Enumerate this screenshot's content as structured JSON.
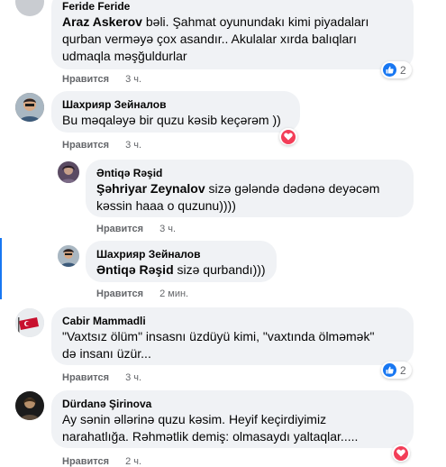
{
  "comments": [
    {
      "author": "Feride Feride",
      "mention": "Araz Askerov",
      "text": " bəli. Şahmat oyunundakı kimi piyadaları qurban verməyə çox asandır.. Akulalar xırda balıqları udmaqla məşğuldurlar",
      "line1": " bəli. Şahmat oyunundakı kimi piyadaları",
      "line2": "qurban verməyə çox asandır.. Akulalar xırda balıqları",
      "line3": "udmaqla məşğuldurlar",
      "like_label": "Нравится",
      "time": "3 ч.",
      "reaction_count": "2"
    },
    {
      "author": "Шахрияр Зейналов",
      "text": "Bu məqaləyə bir quzu kəsib keçərəm ))",
      "like_label": "Нравится",
      "time": "3 ч."
    },
    {
      "author": "Əntiqə Rəşid",
      "mention": "Şəhriyar Zeynalov",
      "line1": " sizə gələndə dədənə deyəcəm",
      "line2": "kəssin haaa o quzunu))))",
      "like_label": "Нравится",
      "time": "3 ч."
    },
    {
      "author": "Шахрияр Зейналов",
      "mention": "Əntiqə Rəşid",
      "line1": " sizə qurbandı)))",
      "like_label": "Нравится",
      "time": "2 мин."
    },
    {
      "author": "Cabir Mammadli",
      "line1": "\"Vaxtsız ölüm\" insasnı üzdüyü kimi, \"vaxtında ölməmək\"",
      "line2": "də insanı üzür...",
      "like_label": "Нравится",
      "time": "3 ч.",
      "reaction_count": "2"
    },
    {
      "author": "Dürdanə Şirinova",
      "line1": "Ay sənin əllərinə quzu kəsim. Heyif keçirdiyimiz",
      "line2": "narahatlığa. Rəhmətlik demiş: olmasaydı yaltaqlar.....",
      "like_label": "Нравится",
      "time": "2 ч."
    }
  ],
  "colors": {
    "bubble": "#f0f2f5",
    "meta": "#65676b",
    "like_blue": "#1877f2",
    "love_red": "#f33e58"
  }
}
